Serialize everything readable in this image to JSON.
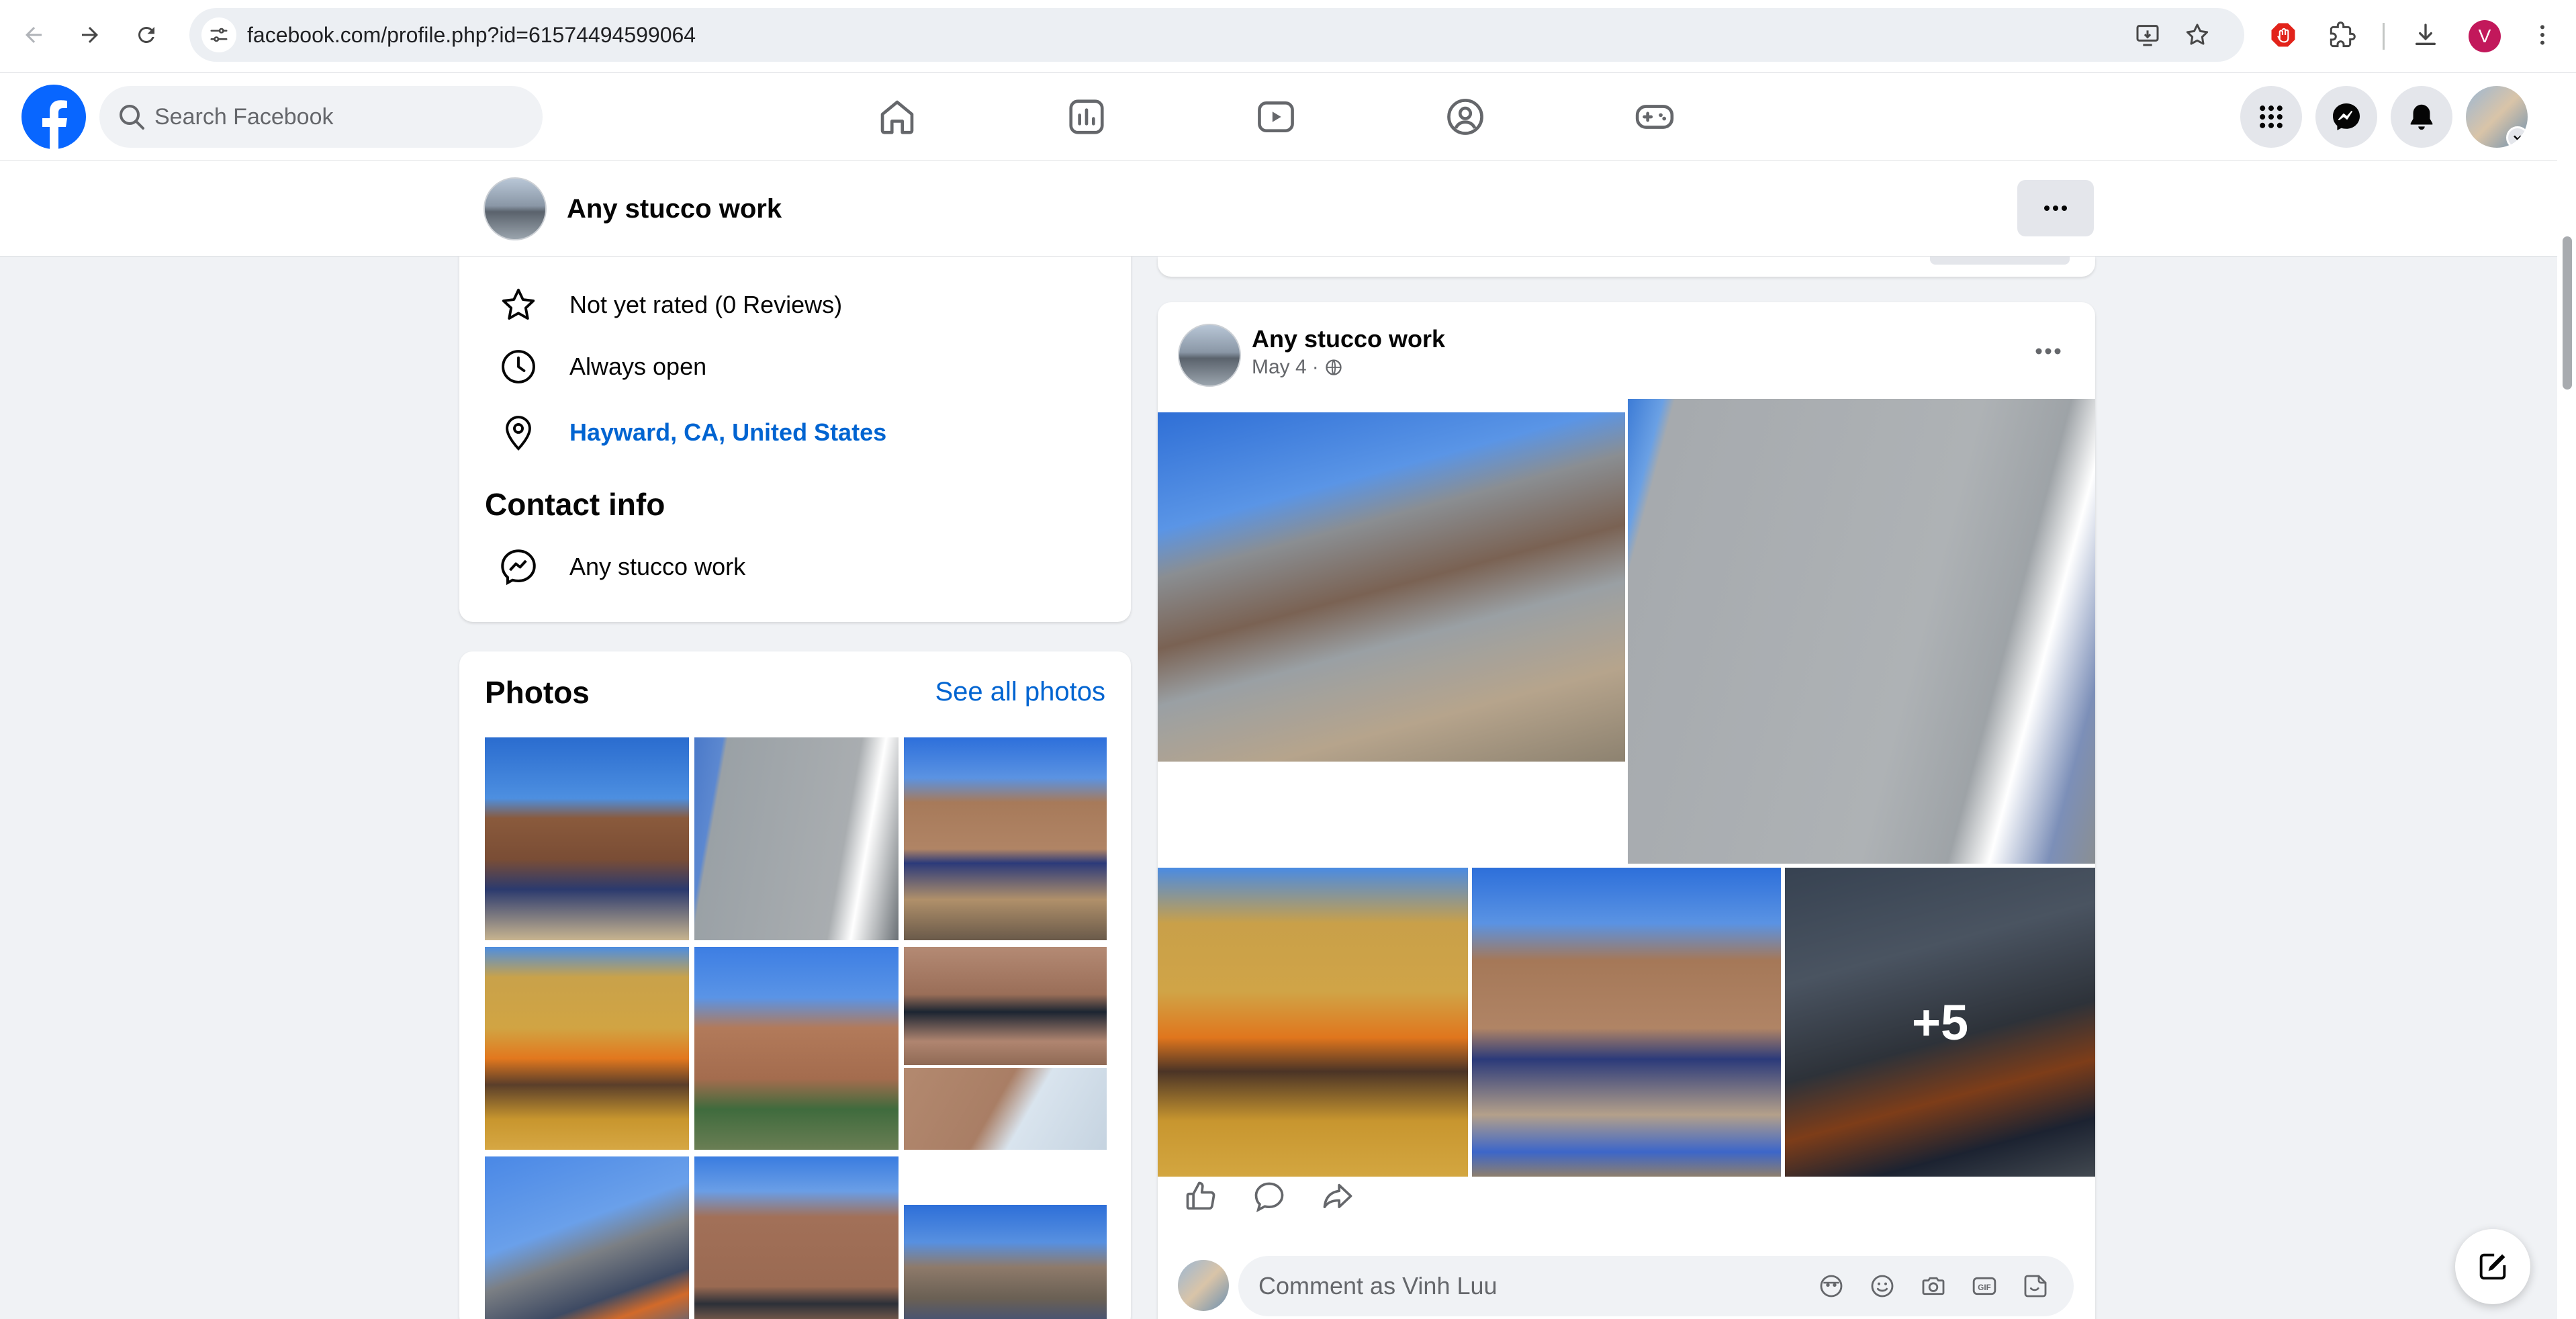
{
  "browser": {
    "url": "facebook.com/profile.php?id=61574494599064",
    "profile_initial": "V"
  },
  "fb": {
    "search_placeholder": "Search Facebook",
    "brand_color": "#0866ff",
    "nav_icons": [
      "home-icon",
      "feeds-icon",
      "video-icon",
      "groups-icon",
      "gaming-icon"
    ],
    "right_icons": [
      "menu-grid-icon",
      "messenger-icon",
      "notifications-icon"
    ]
  },
  "page_header": {
    "name": "Any stucco work"
  },
  "intro": {
    "rating": "Not yet rated (0 Reviews)",
    "hours": "Always open",
    "location": "Hayward, CA, United States",
    "contact_title": "Contact info",
    "contact_messenger": "Any stucco work"
  },
  "photos": {
    "title": "Photos",
    "see_all": "See all photos"
  },
  "post": {
    "author": "Any stucco work",
    "date": "May 4",
    "more_count": "+5"
  },
  "comment": {
    "placeholder": "Comment as Vinh Luu"
  }
}
